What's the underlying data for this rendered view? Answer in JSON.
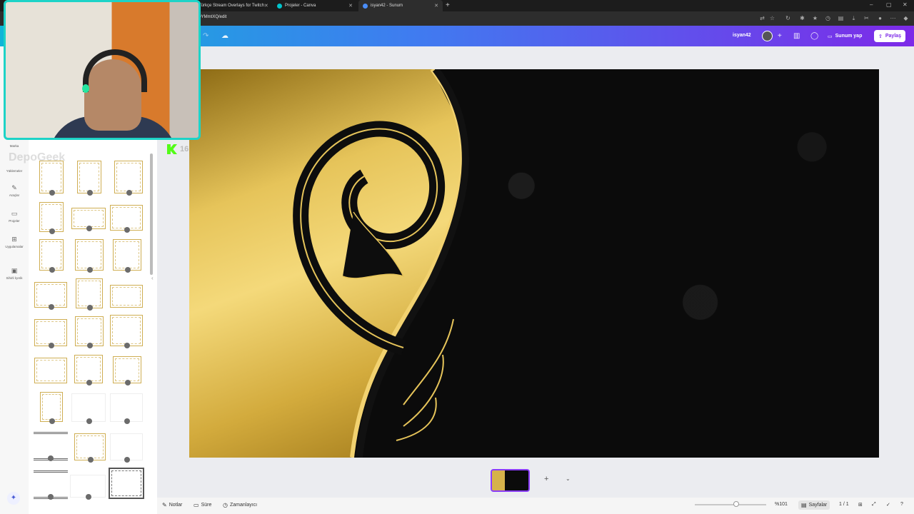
{
  "browser": {
    "tabs": [
      {
        "label": "Türkçe Stream Overlays for Twitch",
        "active": false
      },
      {
        "label": "Projeler - Canva",
        "active": false
      },
      {
        "label": "isyan42 - Sunum",
        "active": true
      }
    ],
    "url": "OYMmtXQ/edit"
  },
  "header": {
    "username": "isyan42",
    "present_button": "Sunum yap",
    "share_button": "Paylaş"
  },
  "leftnav": {
    "items": [
      {
        "label": "Marka"
      },
      {
        "label": "Yüklemeler"
      },
      {
        "label": "Araçlar"
      },
      {
        "label": "Projeler"
      },
      {
        "label": "Uygulamalar"
      },
      {
        "label": "Sihirli İçerik"
      }
    ]
  },
  "overlay": {
    "viewer_count": "16",
    "watermark": "DepoGeek"
  },
  "bottombar": {
    "notes": "Notlar",
    "duration": "Süre",
    "timer": "Zamanlayıcı",
    "zoom": "%101",
    "pages": "Sayfalar",
    "page_count": "1 / 1"
  },
  "colors": {
    "accent": "#8b3dff",
    "header_start": "#0fb5d8",
    "header_end": "#7d2ae8",
    "gold": "#e6c45a",
    "webcam_border": "#1dd3c7"
  }
}
